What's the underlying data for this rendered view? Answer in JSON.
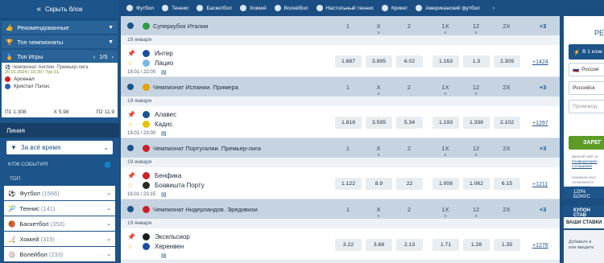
{
  "sidebar": {
    "hide_label": "Скрыть блок",
    "recommended": "Рекомендованные",
    "top_championships": "Топ чемпионаты",
    "top_games": "Топ Игры",
    "top_games_pager": "1/5",
    "featured": {
      "league": "Чемпионат Англии. Премьер-лига",
      "date": "20.01.2024 / 15:30 / Тур 21",
      "team1": "Арсенал",
      "team2": "Кристал Пэлэс",
      "odds": [
        {
          "label": "П1",
          "value": "1.308"
        },
        {
          "label": "X",
          "value": "5.98"
        },
        {
          "label": "П2",
          "value": "11.9"
        }
      ]
    },
    "line_title": "Линия",
    "period": "За всё время",
    "events_count": "6708 СОБЫТИЯ",
    "top_label": "ТОП",
    "sports": [
      {
        "name": "Футбол",
        "count": "(1566)"
      },
      {
        "name": "Теннис",
        "count": "(141)"
      },
      {
        "name": "Баскетбол",
        "count": "(353)"
      },
      {
        "name": "Хоккей",
        "count": "(315)"
      },
      {
        "name": "Волейбол",
        "count": "(233)"
      }
    ]
  },
  "topbar": {
    "sports": [
      "Футбол",
      "Теннис",
      "Баскетбол",
      "Хоккей",
      "Волейбол",
      "Настольный теннис",
      "Крикет",
      "Американский футбол"
    ],
    "more": "›"
  },
  "table": {
    "headers": [
      "1",
      "X",
      "2",
      "1X",
      "12",
      "2X",
      "+3"
    ],
    "championships": [
      {
        "name": "Суперкубок Италии",
        "flag_color": "#2e9a45",
        "date": "19 января",
        "team1": "Интер",
        "team2": "Лацио",
        "time": "19.01 / 22:00",
        "odds": [
          "1.687",
          "3.895",
          "6.02",
          "1.163",
          "1.3",
          "2.309"
        ],
        "more": "+1424"
      },
      {
        "name": "Чемпионат Испании. Примера",
        "flag_color": "#e5a100",
        "date": "19 января",
        "team1": "Алавес",
        "team2": "Кадис",
        "time": "19.01 / 23:00",
        "odds": [
          "1.818",
          "3.595",
          "5.34",
          "1.193",
          "1.338",
          "2.102"
        ],
        "more": "+1297"
      },
      {
        "name": "Чемпионат Португалии. Премьер-лига",
        "flag_color": "#c9202a",
        "date": "19 января",
        "team1": "Бенфика",
        "team2": "Боавишта Порту",
        "time": "19.01 / 23:15",
        "odds": [
          "1.122",
          "8.9",
          "22",
          "1.008",
          "1.062",
          "6.15"
        ],
        "more": "+1211"
      },
      {
        "name": "Чемпионат Нидерландов. Эредивизи",
        "flag_color": "#c9202a",
        "date": "19 января",
        "team1": "Эксельсиор",
        "team2": "Херенвен",
        "time": "",
        "odds": [
          "3.22",
          "3.68",
          "2.13",
          "1.71",
          "1.28",
          "1.35"
        ],
        "more": "+1276"
      }
    ],
    "sub_marker": "v"
  },
  "right": {
    "title": "РЕГ",
    "oneclick": "В 1 клик",
    "country": "Россия",
    "currency": "Российск",
    "promo": "Промокод",
    "register": "ЗАРЕГ",
    "note1": "Данный сайт за",
    "note_link1": "Конфиденциал",
    "note2": "соглашение",
    "note3": "Нажимая кноп",
    "note4": "ознакомился",
    "note_link2": "политикой",
    "note5": "правил и по",
    "bonus": "120% БОНУС",
    "coupon": "КУПОН СТАВ",
    "bets_label": "ВАШИ СТАВКИ",
    "bets_text1": "Добавьте в",
    "bets_text2": "или введите"
  },
  "colors": {
    "primary": "#1d5489",
    "green": "#5d9b27"
  }
}
